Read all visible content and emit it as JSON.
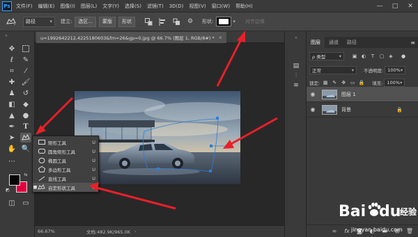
{
  "app": {
    "logo": "Ps",
    "menu": [
      "文件(F)",
      "编辑(E)",
      "图像(I)",
      "图层(L)",
      "文字(Y)",
      "选择(S)",
      "滤镜(T)",
      "3D(D)",
      "视图(V)",
      "窗口(W)",
      "帮助(H)"
    ],
    "window_controls": [
      "—",
      "□",
      "✕"
    ]
  },
  "options_bar": {
    "mode": "路径",
    "make_label": "建立:",
    "selection_btn": "选区...",
    "mask_btn": "蒙版",
    "shape_btn": "形状",
    "shape_label": "形状:",
    "align_edges": "对齐边缘"
  },
  "document": {
    "tab_title": "u=1992642212,4225180603&fm=26&gp=0.jpg @ 66.7% (图层 1, RGB/8#) *",
    "tab_close": "×",
    "zoom": "66.67%",
    "doc_info": "文档:482.9K/965.0K",
    "status_arrow": "›"
  },
  "colors": {
    "foreground": "#050505",
    "background": "#e1003c",
    "annotation_arrow": "#e8202a",
    "path_line": "#2b7fd9"
  },
  "flyout": {
    "items": [
      {
        "label": "矩形工具",
        "shortcut": "U",
        "icon": "rectangle-icon",
        "selected": false
      },
      {
        "label": "圆角矩形工具",
        "shortcut": "U",
        "icon": "rounded-rectangle-icon",
        "selected": false
      },
      {
        "label": "椭圆工具",
        "shortcut": "U",
        "icon": "ellipse-icon",
        "selected": false
      },
      {
        "label": "多边形工具",
        "shortcut": "U",
        "icon": "polygon-icon",
        "selected": false
      },
      {
        "label": "直线工具",
        "shortcut": "U",
        "icon": "line-icon",
        "selected": false
      },
      {
        "label": "自定形状工具",
        "shortcut": "U",
        "icon": "custom-shape-icon",
        "selected": true
      }
    ]
  },
  "layers_panel": {
    "tabs": [
      "图层",
      "通道",
      "路径"
    ],
    "menu_glyph": "≡",
    "filter_kind": "ρ 类型",
    "blend_mode": "正常",
    "opacity_label": "不透明度:",
    "opacity_value": "100%",
    "lock_label": "锁定:",
    "fill_label": "填充:",
    "fill_value": "100%",
    "layers": [
      {
        "name": "图层 1",
        "selected": true,
        "locked": false
      },
      {
        "name": "背景",
        "selected": false,
        "locked": true
      }
    ]
  },
  "watermark": {
    "brand": "Bai",
    "brand_suffix": "du",
    "brand_cn": "经验",
    "url": "jingyan.baidu.com"
  }
}
